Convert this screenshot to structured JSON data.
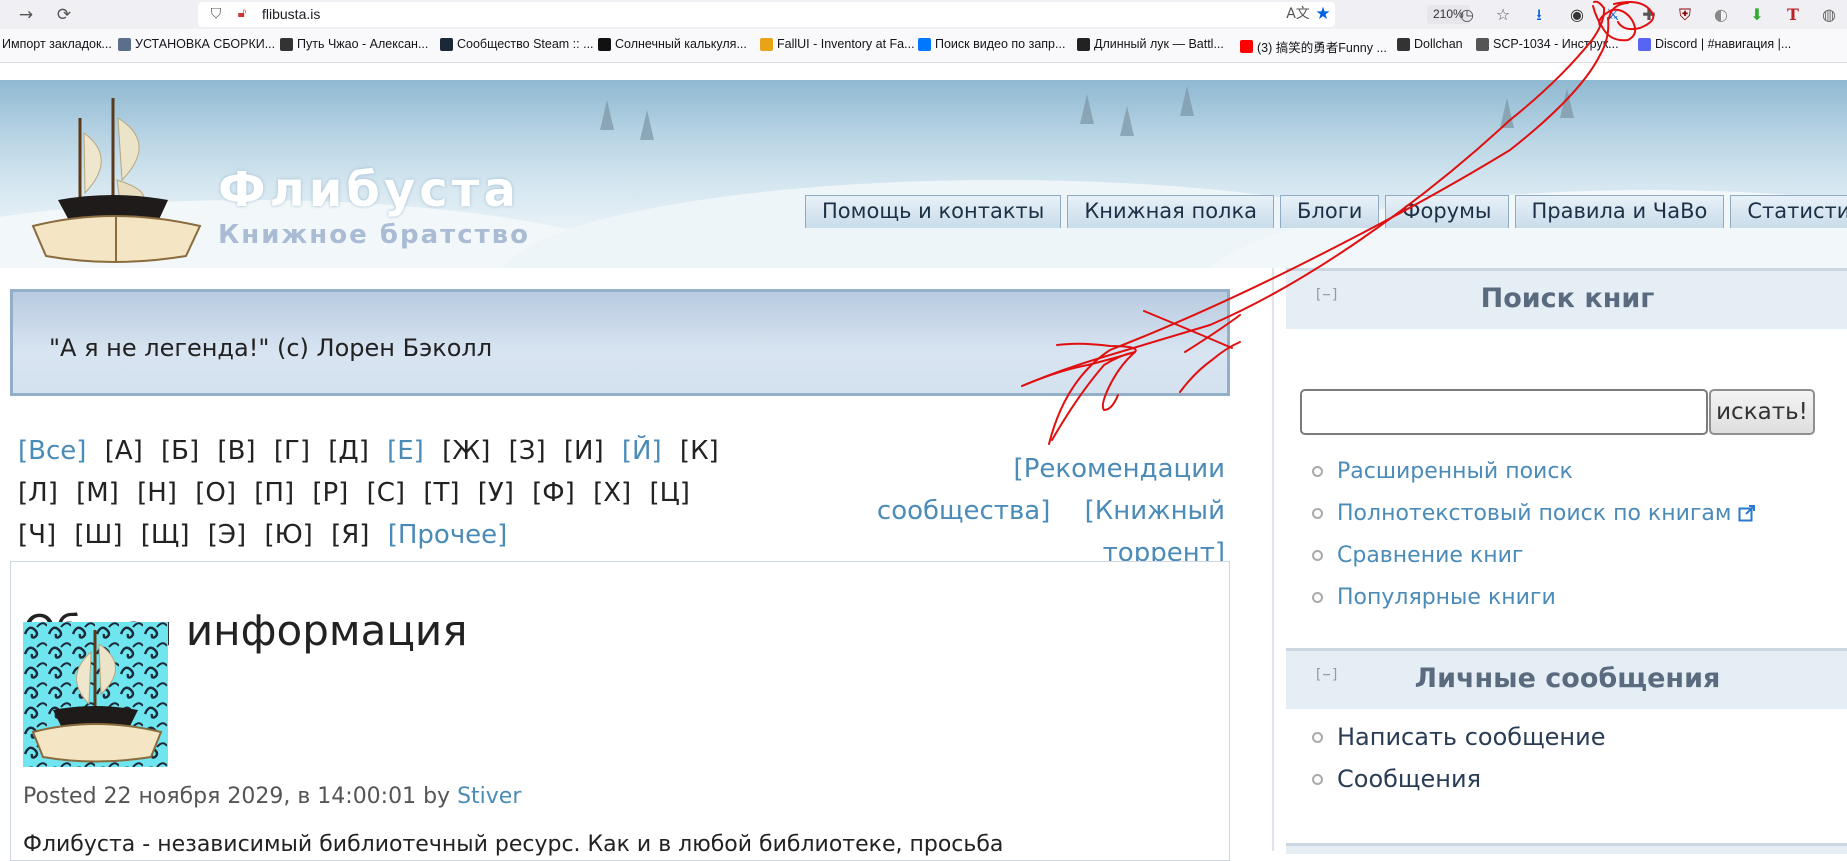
{
  "browser": {
    "url": "flibusta.is",
    "zoom": "210%",
    "bookmarks": [
      {
        "label": "Импорт закладок...",
        "icon": "folder-icon",
        "color": "#f9f9fb"
      },
      {
        "label": "УСТАНОВКА СБОРКИ...",
        "icon": "gear-icon",
        "color": "#5b6e8a"
      },
      {
        "label": "Путь Чжао - Алексан...",
        "icon": "fighter-icon",
        "color": "#333333"
      },
      {
        "label": "Сообщество Steam :: ...",
        "icon": "steam-icon",
        "color": "#1b2838"
      },
      {
        "label": "Солнечный калькуля...",
        "icon": "m-icon",
        "color": "#111111"
      },
      {
        "label": "FallUI - Inventory at Fa...",
        "icon": "nexus-icon",
        "color": "#e8a317"
      },
      {
        "label": "Поиск видео по запр...",
        "icon": "vk-icon",
        "color": "#0077ff"
      },
      {
        "label": "Длинный лук — Battl...",
        "icon": "knight-icon",
        "color": "#222222"
      },
      {
        "label": "(3) 搞笑的勇者Funny ...",
        "icon": "youtube-icon",
        "color": "#ff0000"
      },
      {
        "label": "Dollchan",
        "icon": "dollchan-icon",
        "color": "#333333"
      },
      {
        "label": "SCP-1034 - Инструк...",
        "icon": "scp-icon",
        "color": "#555555"
      },
      {
        "label": "Discord | #навигация |...",
        "icon": "discord-icon",
        "color": "#5865f2"
      }
    ]
  },
  "site": {
    "title": "Флибуста",
    "slogan": "Книжное братство",
    "nav": [
      "Помощь и контакты",
      "Книжная полка",
      "Блоги",
      "Форумы",
      "Правила и ЧаВо",
      "Статистика"
    ]
  },
  "quote": "\"А я не легенда!\" (с) Лорен Бэколл",
  "alphabet": [
    {
      "t": "[Все]",
      "link": true
    },
    {
      "t": "[А]",
      "link": false
    },
    {
      "t": "[Б]",
      "link": false
    },
    {
      "t": "[В]",
      "link": false
    },
    {
      "t": "[Г]",
      "link": false
    },
    {
      "t": "[Д]",
      "link": false
    },
    {
      "t": "[Е]",
      "link": true
    },
    {
      "t": "[Ж]",
      "link": false
    },
    {
      "t": "[З]",
      "link": false
    },
    {
      "t": "[И]",
      "link": false
    },
    {
      "t": "[Й]",
      "link": true
    },
    {
      "t": "[К]",
      "link": false
    },
    {
      "t": "[Л]",
      "link": false
    },
    {
      "t": "[М]",
      "link": false
    },
    {
      "t": "[Н]",
      "link": false
    },
    {
      "t": "[О]",
      "link": false
    },
    {
      "t": "[П]",
      "link": false
    },
    {
      "t": "[Р]",
      "link": false
    },
    {
      "t": "[С]",
      "link": false
    },
    {
      "t": "[Т]",
      "link": false
    },
    {
      "t": "[У]",
      "link": false
    },
    {
      "t": "[Ф]",
      "link": false
    },
    {
      "t": "[Х]",
      "link": false
    },
    {
      "t": "[Ц]",
      "link": false
    },
    {
      "t": "[Ч]",
      "link": false
    },
    {
      "t": "[Ш]",
      "link": false
    },
    {
      "t": "[Щ]",
      "link": false
    },
    {
      "t": "[Э]",
      "link": false
    },
    {
      "t": "[Ю]",
      "link": false
    },
    {
      "t": "[Я]",
      "link": false
    },
    {
      "t": "[Прочее]",
      "link": true
    }
  ],
  "extra_links": {
    "recommend_line1": "[Рекомендации",
    "recommend_line2": "сообщества]",
    "torrent": "[Книжный торрент]"
  },
  "node": {
    "title": "Общая информация",
    "posted_prefix": "Posted 22 ноября 2029, в 14:00:01 by",
    "author": "Stiver",
    "body": "Флибуста - независимый библиотечный ресурс. Как и в любой библиотеке, просьба"
  },
  "sidebar": {
    "collapse": "[−]",
    "search": {
      "title": "Поиск книг",
      "button": "искать!",
      "links": [
        "Расширенный поиск",
        "Полнотекстовый поиск по книгам",
        "Сравнение книг",
        "Популярные книги"
      ]
    },
    "messages": {
      "title": "Личные сообщения",
      "links": [
        "Написать сообщение",
        "Сообщения"
      ]
    }
  },
  "colors": {
    "link": "#4b8bb8",
    "annotation": "#e01010"
  }
}
